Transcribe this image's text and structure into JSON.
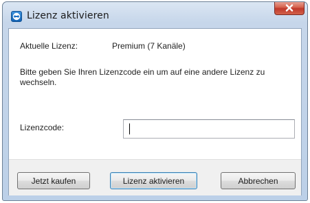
{
  "window": {
    "title": "Lizenz aktivieren"
  },
  "content": {
    "current_license_label": "Aktuelle Lizenz:",
    "current_license_value": "Premium (7 Kanäle)",
    "info_text": "Bitte geben Sie Ihren Lizenzcode ein um auf eine andere Lizenz zu wechseln.",
    "license_code_label": "Lizenzcode:",
    "license_code_value": ""
  },
  "buttons": {
    "buy": "Jetzt kaufen",
    "activate": "Lizenz aktivieren",
    "cancel": "Abbrechen"
  },
  "icons": {
    "app": "teamviewer-icon",
    "close": "close-icon"
  },
  "colors": {
    "close_button": "#c0392b",
    "default_button_border": "#3c7fb1"
  }
}
